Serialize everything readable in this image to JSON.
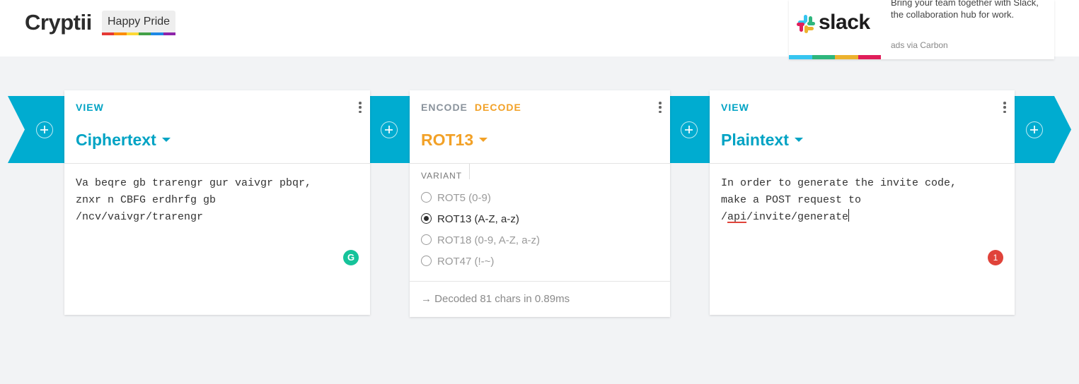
{
  "app": {
    "title": "Cryptii",
    "badge": "Happy Pride"
  },
  "pride_colors": [
    "#e53935",
    "#fb8c00",
    "#fdd835",
    "#43a047",
    "#1e88e5",
    "#8e24aa"
  ],
  "ad": {
    "brand": "slack",
    "text": "Bring your team together with Slack, the collaboration hub for work.",
    "via": "ads via Carbon",
    "stripe_colors": [
      "#36c5f0",
      "#2eb67d",
      "#ecb22e",
      "#e01e5a"
    ]
  },
  "colors": {
    "accent": "#00acd0",
    "orange": "#f2a127",
    "background": "#f2f3f5"
  },
  "cards": {
    "input": {
      "label": "VIEW",
      "title": "Ciphertext",
      "text": "Va beqre gb trarengr gur vaivgr pbqr,\nznxr n CBFG erdhrfg gb\n/ncv/vaivgr/trarengr"
    },
    "cipher": {
      "label_encode": "ENCODE",
      "label_decode": "DECODE",
      "title": "ROT13",
      "variant_label": "VARIANT",
      "variants": [
        {
          "label": "ROT5 (0-9)",
          "selected": false
        },
        {
          "label": "ROT13 (A-Z, a-z)",
          "selected": true
        },
        {
          "label": "ROT18 (0-9, A-Z, a-z)",
          "selected": false
        },
        {
          "label": "ROT47 (!-~)",
          "selected": false
        }
      ],
      "status": "→ Decoded 81 chars in 0.89ms"
    },
    "output": {
      "label": "VIEW",
      "title": "Plaintext",
      "line1": "In order to generate the invite code,",
      "line2": "make a POST request to",
      "line3_prefix": "/",
      "line3_flagged": "api",
      "line3_suffix": "/invite/generate",
      "error_count": "1"
    }
  }
}
